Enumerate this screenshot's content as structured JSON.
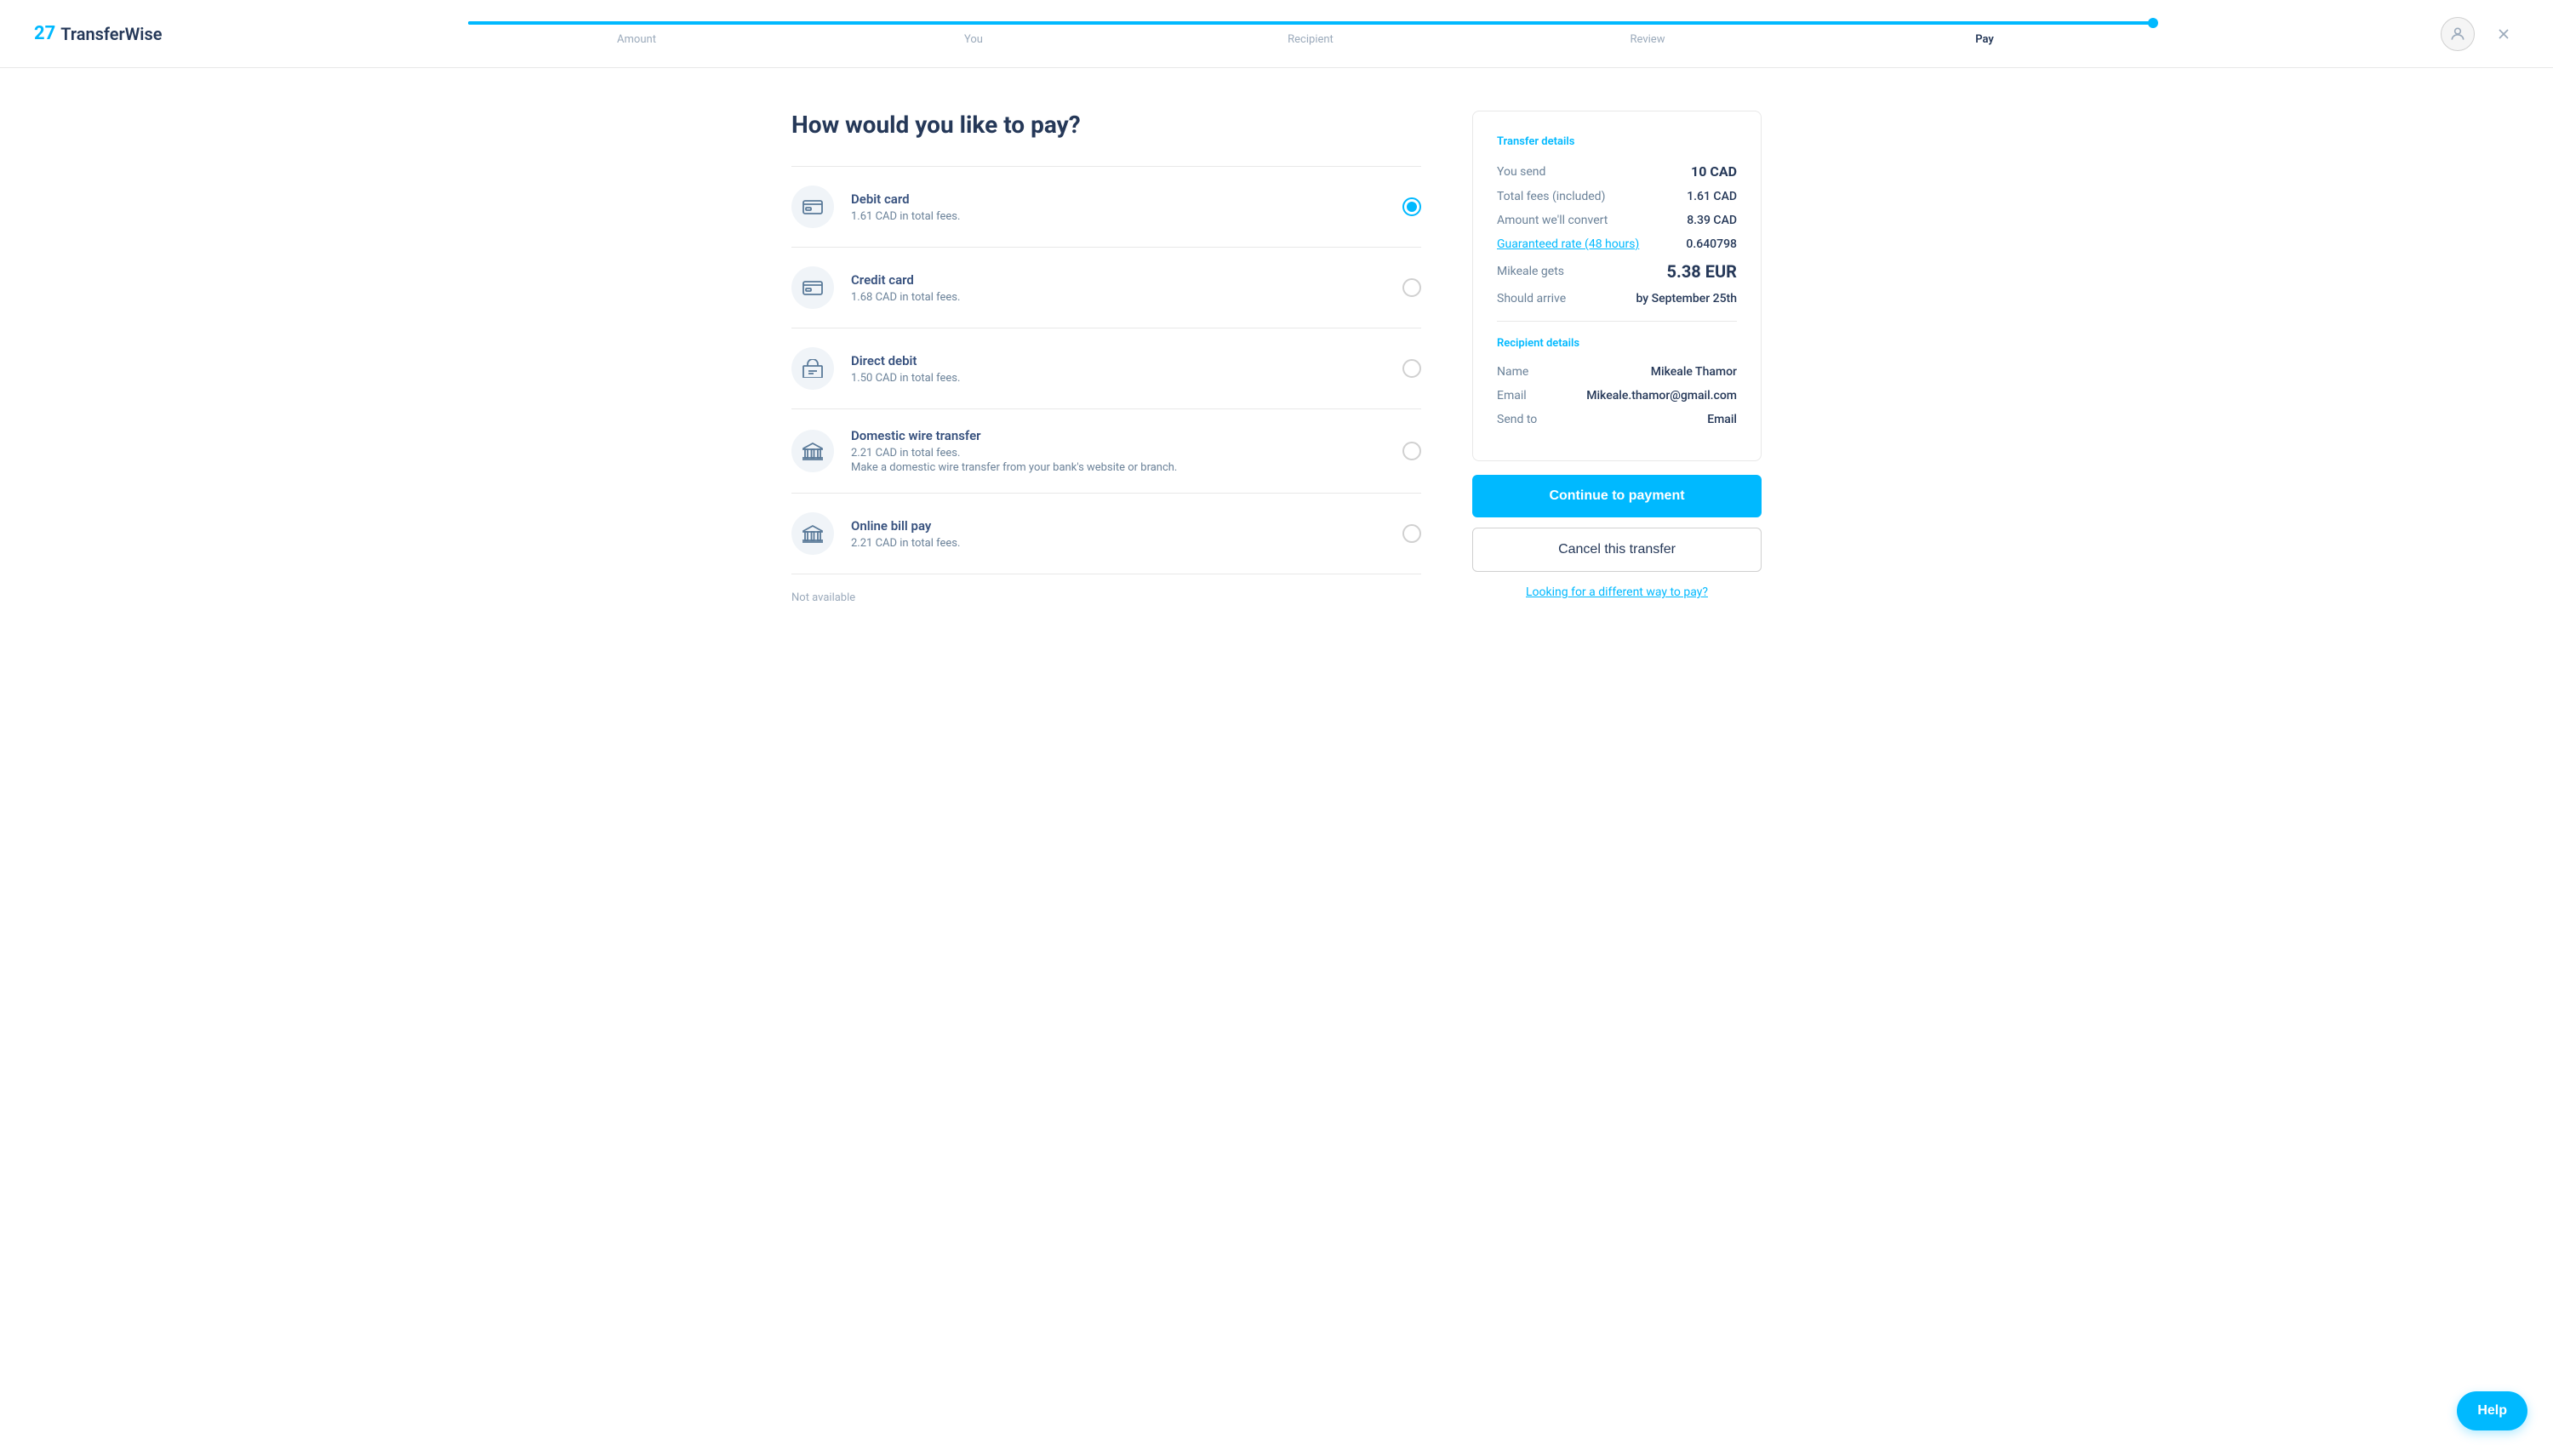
{
  "header": {
    "logo_icon": "27",
    "logo_text": "TransferWise",
    "progress_percent": 100,
    "steps": [
      {
        "label": "Amount",
        "active": false
      },
      {
        "label": "You",
        "active": false
      },
      {
        "label": "Recipient",
        "active": false
      },
      {
        "label": "Review",
        "active": false
      },
      {
        "label": "Pay",
        "active": true
      }
    ]
  },
  "page": {
    "title": "How would you like to pay?"
  },
  "payment_options": [
    {
      "name": "Debit card",
      "fee": "1.61 CAD in total fees.",
      "desc": "",
      "selected": true,
      "icon": "💳"
    },
    {
      "name": "Credit card",
      "fee": "1.68 CAD in total fees.",
      "desc": "",
      "selected": false,
      "icon": "💳"
    },
    {
      "name": "Direct debit",
      "fee": "1.50 CAD in total fees.",
      "desc": "",
      "selected": false,
      "icon": "🏦"
    },
    {
      "name": "Domestic wire transfer",
      "fee": "2.21 CAD in total fees.",
      "desc": "Make a domestic wire transfer from your bank's website or branch.",
      "selected": false,
      "icon": "🏛"
    },
    {
      "name": "Online bill pay",
      "fee": "2.21 CAD in total fees.",
      "desc": "",
      "selected": false,
      "icon": "🏛"
    }
  ],
  "not_available_label": "Not available",
  "transfer_details": {
    "section_title": "Transfer details",
    "you_send_label": "You send",
    "you_send_value": "10 CAD",
    "total_fees_label": "Total fees (included)",
    "total_fees_value": "1.61 CAD",
    "amount_convert_label": "Amount we'll convert",
    "amount_convert_value": "8.39 CAD",
    "guaranteed_rate_label": "Guaranteed rate (48 hours)",
    "guaranteed_rate_value": "0.640798",
    "recipient_gets_label": "Mikeale gets",
    "recipient_gets_value": "5.38 EUR",
    "should_arrive_label": "Should arrive",
    "should_arrive_value": "by September 25th"
  },
  "recipient_details": {
    "section_title": "Recipient details",
    "name_label": "Name",
    "name_value": "Mikeale Thamor",
    "email_label": "Email",
    "email_value": "Mikeale.thamor@gmail.com",
    "send_to_label": "Send to",
    "send_to_value": "Email"
  },
  "buttons": {
    "continue": "Continue to payment",
    "cancel": "Cancel this transfer",
    "different_way": "Looking for a different way to pay?",
    "help": "Help"
  }
}
